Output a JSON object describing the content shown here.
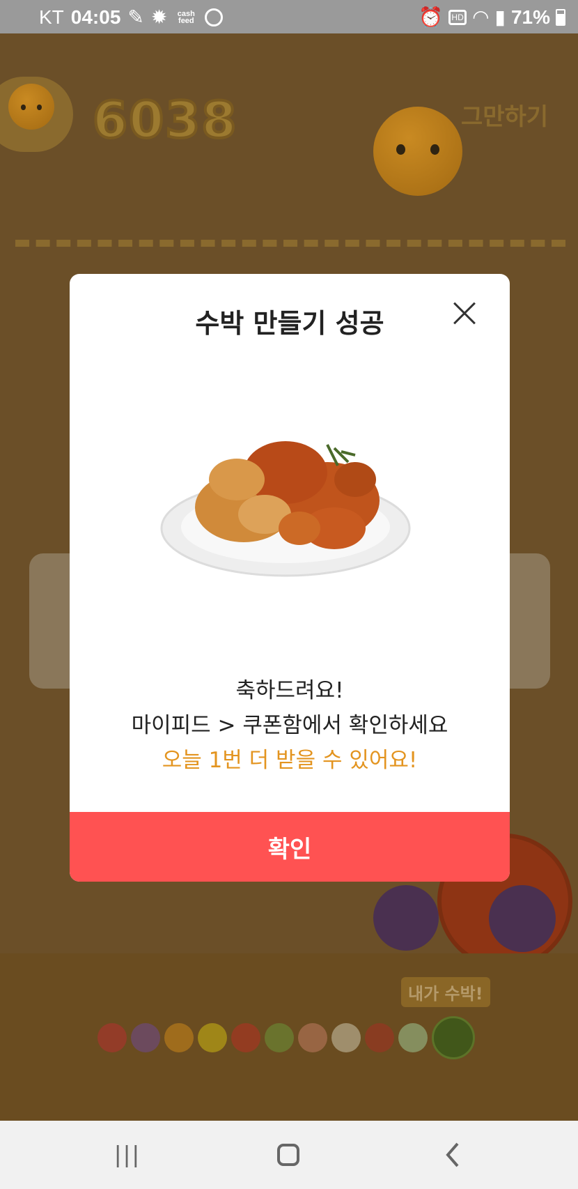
{
  "status_bar": {
    "carrier": "KT",
    "time": "04:05",
    "cash_feed": "cash feed",
    "hd": "HD",
    "battery": "71%"
  },
  "game": {
    "score": "6038",
    "quit_label": "그만하기",
    "my_watermelon_label": "내가 수박!"
  },
  "modal": {
    "title": "수박 만들기 성공",
    "line1": "축하드려요!",
    "line2": "마이피드 > 쿠폰함에서 확인하세요",
    "line3": "오늘 1번 더 받을 수 있어요!",
    "confirm_label": "확인",
    "highlight_color": "#e3941f",
    "button_color": "#ff5252"
  },
  "nav": {
    "recents": "|||",
    "back": "<"
  }
}
